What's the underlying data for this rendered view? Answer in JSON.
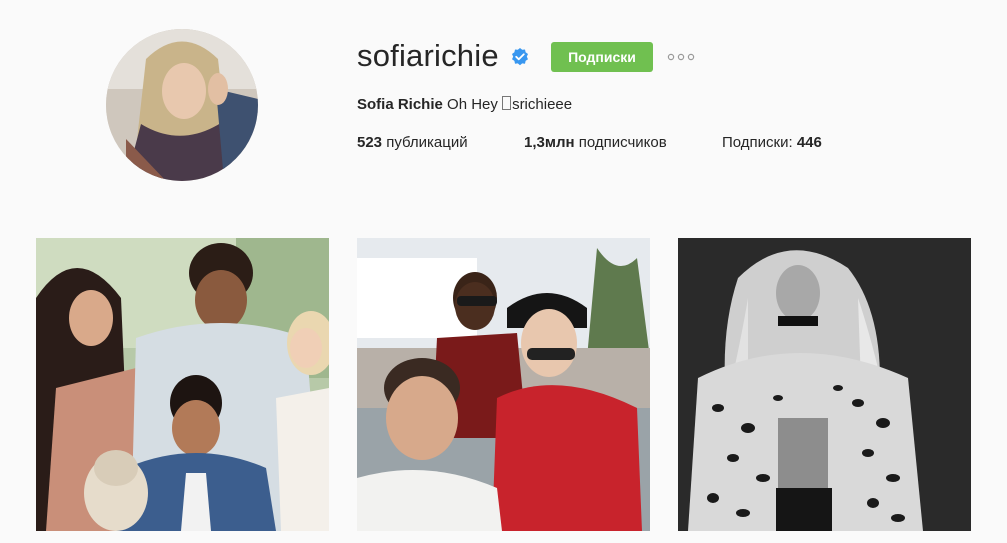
{
  "profile": {
    "username": "sofiarichie",
    "verified": true,
    "follow_label": "Подписки",
    "more_icon": "ellipsis-icon",
    "full_name": "Sofia Richie",
    "bio_text": "Oh Hey",
    "bio_handle": "srichieee"
  },
  "stats": {
    "posts_count": "523",
    "posts_label": "публикаций",
    "followers_count": "1,3млн",
    "followers_label": "подписчиков",
    "following_label": "Подписки:",
    "following_count": "446"
  },
  "colors": {
    "follow_button": "#70c050",
    "verified_badge": "#3897f0",
    "background": "#fafafa"
  },
  "posts": [
    {
      "label": "family-photo"
    },
    {
      "label": "selfie-with-friends"
    },
    {
      "label": "black-and-white-portrait"
    }
  ]
}
